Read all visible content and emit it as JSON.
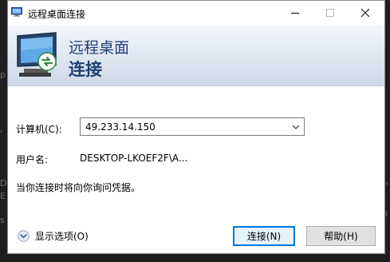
{
  "window": {
    "title": "远程桌面连接"
  },
  "banner": {
    "title_line1": "远程桌面",
    "title_line2": "连接"
  },
  "form": {
    "computer_label": "计算机(C):",
    "computer_value": "49.233.14.150",
    "username_label": "用户名:",
    "username_value": "DESKTOP-LKOEF2F\\A...",
    "prompt_text": "当你连接时将向你询问凭据。"
  },
  "footer": {
    "show_options_label": "显示选项(O)",
    "connect_label": "连接(N)",
    "help_label": "帮助(H)"
  },
  "colors": {
    "accent": "#0078d7",
    "banner_title": "#1f3f73"
  }
}
